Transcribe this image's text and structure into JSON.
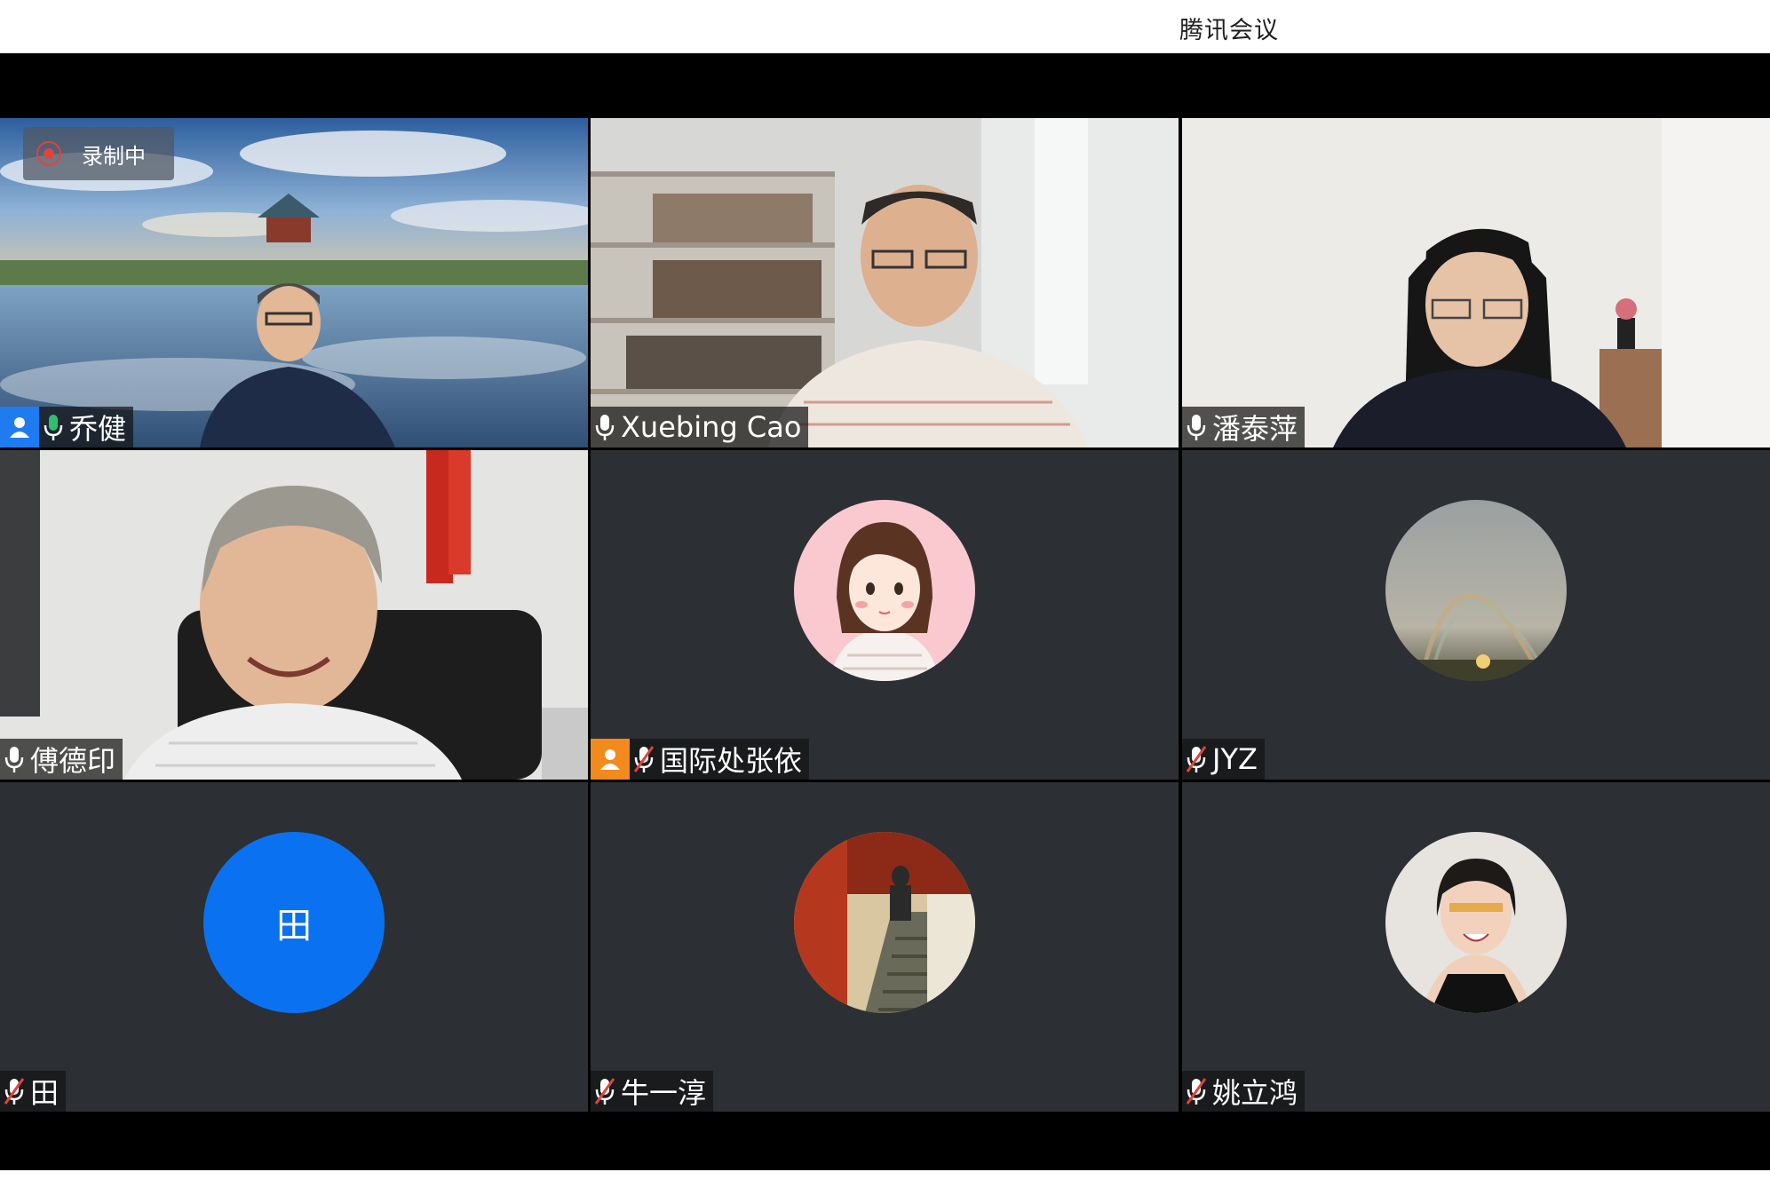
{
  "window": {
    "title": "腾讯会议"
  },
  "recording": {
    "label": "录制中"
  },
  "participants": [
    {
      "name": "乔健",
      "mic": "on",
      "host": true
    },
    {
      "name": "Xuebing Cao",
      "mic": "on",
      "host": false
    },
    {
      "name": "潘泰萍",
      "mic": "on",
      "host": false
    },
    {
      "name": "傅德印",
      "mic": "on",
      "host": false
    },
    {
      "name": "国际处张依",
      "mic": "muted",
      "host": true
    },
    {
      "name": "JYZ",
      "mic": "muted",
      "host": false
    },
    {
      "name": "田",
      "mic": "muted",
      "host": false,
      "avatar_letter": "田"
    },
    {
      "name": "牛一淳",
      "mic": "muted",
      "host": false
    },
    {
      "name": "姚立鸿",
      "mic": "muted",
      "host": false
    }
  ],
  "colors": {
    "tile_bg": "#2c2f33",
    "active_border": "#2fbf71",
    "mic_on": "#2fbf71",
    "letter_avatar": "#0a72f0",
    "host_badge_blue": "#1f7cf0",
    "host_badge_orange": "#f28a1c"
  },
  "icons": [
    "record-icon",
    "microphone-icon",
    "microphone-muted-icon",
    "user-icon"
  ]
}
